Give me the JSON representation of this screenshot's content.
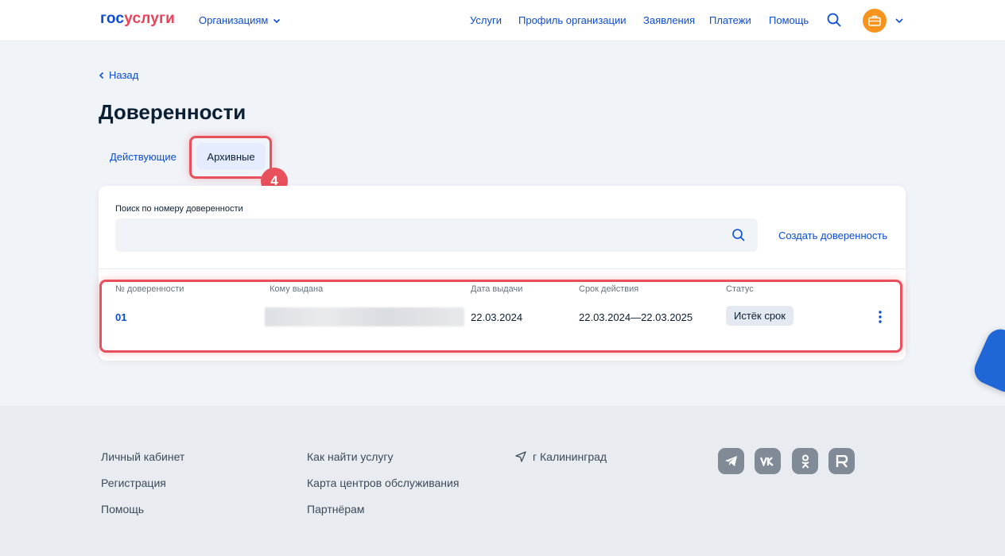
{
  "header": {
    "logo_part1": "гос",
    "logo_part2": "услуги",
    "org_menu": "Организациям",
    "nav": [
      "Услуги",
      "Профиль организации",
      "Заявления",
      "Платежи",
      "Помощь"
    ]
  },
  "main": {
    "back": "Назад",
    "title": "Доверенности",
    "tabs": [
      "Действующие",
      "Архивные"
    ],
    "step_number": "4",
    "search_label": "Поиск по номеру доверенности",
    "search_value": "",
    "create_link": "Создать доверенность",
    "table": {
      "columns": [
        "№ доверенности",
        "Кому выдана",
        "Дата выдачи",
        "Срок действия",
        "Статус"
      ],
      "row": {
        "number": "01",
        "issued_date": "22.03.2024",
        "validity": "22.03.2024—22.03.2025",
        "status": "Истёк срок"
      }
    }
  },
  "footer": {
    "col1": [
      "Личный кабинет",
      "Регистрация",
      "Помощь"
    ],
    "col2": [
      "Как найти услугу",
      "Карта центров обслуживания",
      "Партнёрам"
    ],
    "city": "г Калининград",
    "social": [
      "telegram-icon",
      "vk-icon",
      "odnoklassniki-icon",
      "rutube-icon"
    ]
  },
  "colors": {
    "brand_blue": "#0d4cd3",
    "brand_red": "#ee3f58",
    "highlight": "#e8505b",
    "avatar": "#f7941d"
  }
}
